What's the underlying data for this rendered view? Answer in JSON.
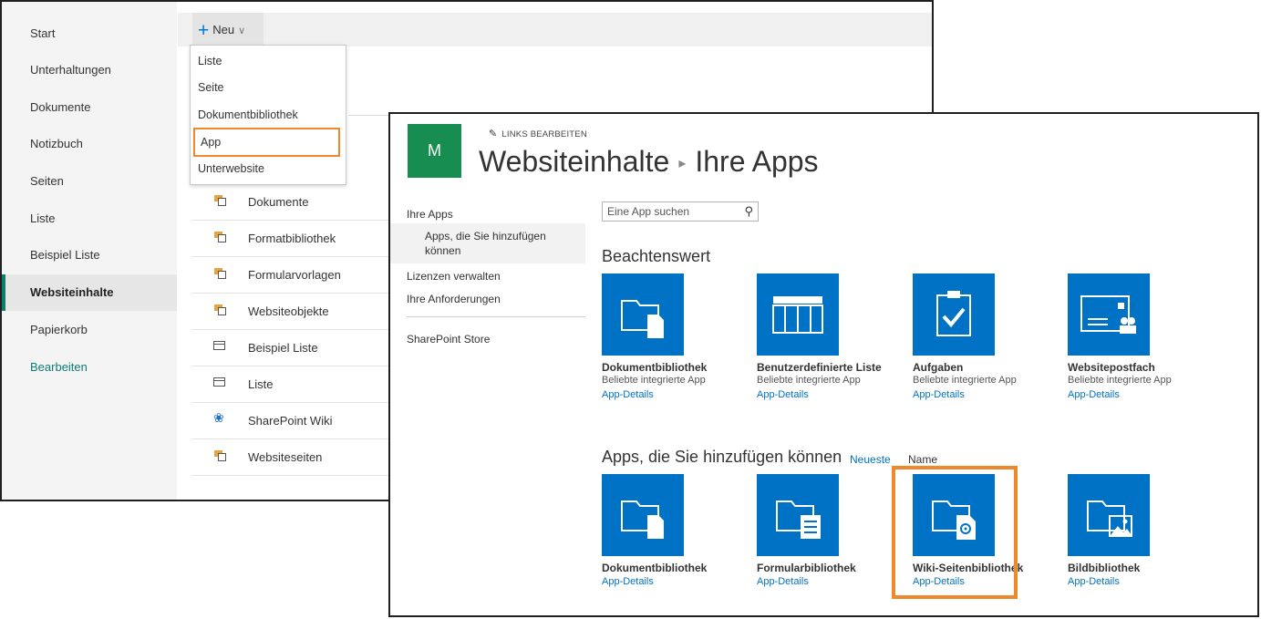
{
  "left_nav": {
    "items": [
      {
        "label": "Start"
      },
      {
        "label": "Unterhaltungen"
      },
      {
        "label": "Dokumente"
      },
      {
        "label": "Notizbuch"
      },
      {
        "label": "Seiten"
      },
      {
        "label": "Liste"
      },
      {
        "label": "Beispiel Liste"
      },
      {
        "label": "Websiteinhalte",
        "active": true
      },
      {
        "label": "Papierkorb"
      }
    ],
    "edit_label": "Bearbeiten"
  },
  "toolbar": {
    "new_label": "Neu"
  },
  "new_menu": {
    "items": [
      "Liste",
      "Seite",
      "Dokumentbibliothek",
      "App",
      "Unterwebsite"
    ],
    "highlighted": "App"
  },
  "content_list": [
    {
      "label": "Dokumente",
      "icon": "library-icon"
    },
    {
      "label": "Formatbibliothek",
      "icon": "library-icon"
    },
    {
      "label": "Formularvorlagen",
      "icon": "library-icon"
    },
    {
      "label": "Websiteobjekte",
      "icon": "library-icon"
    },
    {
      "label": "Beispiel Liste",
      "icon": "list-icon"
    },
    {
      "label": "Liste",
      "icon": "list-icon"
    },
    {
      "label": "SharePoint Wiki",
      "icon": "wiki-icon"
    },
    {
      "label": "Websiteseiten",
      "icon": "library-icon"
    }
  ],
  "apps_page": {
    "logo_letter": "M",
    "edit_links": "LINKS BEARBEITEN",
    "title_part1": "Websiteinhalte",
    "title_part2": "Ihre Apps",
    "side_nav": {
      "your_apps": "Ihre Apps",
      "apps_you_can_add": "Apps, die Sie hinzufügen können",
      "manage_licenses": "Lizenzen verwalten",
      "your_requests": "Ihre Anforderungen",
      "store": "SharePoint Store"
    },
    "search_placeholder": "Eine App suchen",
    "noteworthy_heading": "Beachtenswert",
    "noteworthy": [
      {
        "name": "Dokumentbibliothek",
        "sub": "Beliebte integrierte App",
        "details": "App-Details",
        "icon": "document-library-icon"
      },
      {
        "name": "Benutzerdefinierte Liste",
        "sub": "Beliebte integrierte App",
        "details": "App-Details",
        "icon": "custom-list-icon"
      },
      {
        "name": "Aufgaben",
        "sub": "Beliebte integrierte App",
        "details": "App-Details",
        "icon": "tasks-icon"
      },
      {
        "name": "Websitepostfach",
        "sub": "Beliebte integrierte App",
        "details": "App-Details",
        "icon": "site-mailbox-icon"
      }
    ],
    "addable_heading": "Apps, die Sie hinzufügen können",
    "sort_newest": "Neueste",
    "sort_name": "Name",
    "addable": [
      {
        "name": "Dokumentbibliothek",
        "details": "App-Details",
        "icon": "document-library-icon"
      },
      {
        "name": "Formularbibliothek",
        "details": "App-Details",
        "icon": "form-library-icon"
      },
      {
        "name": "Wiki-Seitenbibliothek",
        "details": "App-Details",
        "icon": "wiki-library-icon",
        "highlighted": true
      },
      {
        "name": "Bildbibliothek",
        "details": "App-Details",
        "icon": "picture-library-icon"
      }
    ]
  },
  "colors": {
    "tile_blue": "#0072c6",
    "highlight_orange": "#f0892c",
    "logo_green": "#188d52",
    "nav_accent": "#107c6c"
  }
}
